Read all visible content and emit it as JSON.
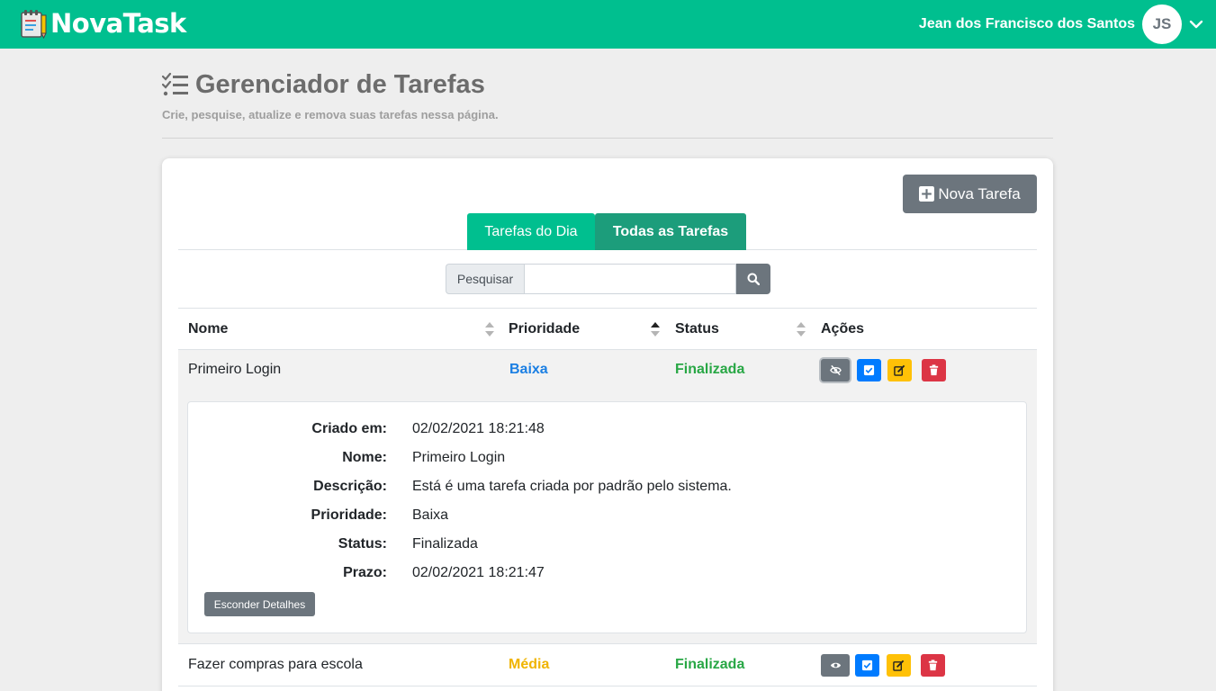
{
  "navbar": {
    "brand": "NovaTask",
    "brand_icon": "notepad-icon",
    "user_name": "Jean dos Francisco dos Santos",
    "avatar_initials": "JS",
    "colors": {
      "primary": "#00bf8f"
    }
  },
  "page": {
    "title": "Gerenciador de Tarefas",
    "title_icon": "tasks-list-icon",
    "subtitle": "Crie, pesquise, atualize e remova suas tarefas nessa página."
  },
  "toolbar": {
    "new_task_label": "Nova Tarefa"
  },
  "tabs": [
    {
      "label": "Tarefas do Dia",
      "active": false
    },
    {
      "label": "Todas as Tarefas",
      "active": true
    }
  ],
  "search": {
    "label": "Pesquisar",
    "value": "",
    "placeholder": ""
  },
  "table": {
    "headers": [
      "Nome",
      "Prioridade",
      "Status",
      "Ações"
    ],
    "sorted_column": "Prioridade",
    "rows": [
      {
        "name": "Primeiro Login",
        "priority": "Baixa",
        "status": "Finalizada",
        "expanded": true,
        "details": [
          {
            "label": "Criado em:",
            "value": "02/02/2021 18:21:48"
          },
          {
            "label": "Nome:",
            "value": "Primeiro Login"
          },
          {
            "label": "Descrição:",
            "value": "Está é uma tarefa criada por padrão pelo sistema."
          },
          {
            "label": "Prioridade:",
            "value": "Baixa"
          },
          {
            "label": "Status:",
            "value": "Finalizada"
          },
          {
            "label": "Prazo:",
            "value": "02/02/2021 18:21:47"
          }
        ],
        "hide_button": "Esconder Detalhes"
      },
      {
        "name": "Fazer compras para escola",
        "priority": "Média",
        "status": "Finalizada",
        "expanded": false
      }
    ]
  }
}
